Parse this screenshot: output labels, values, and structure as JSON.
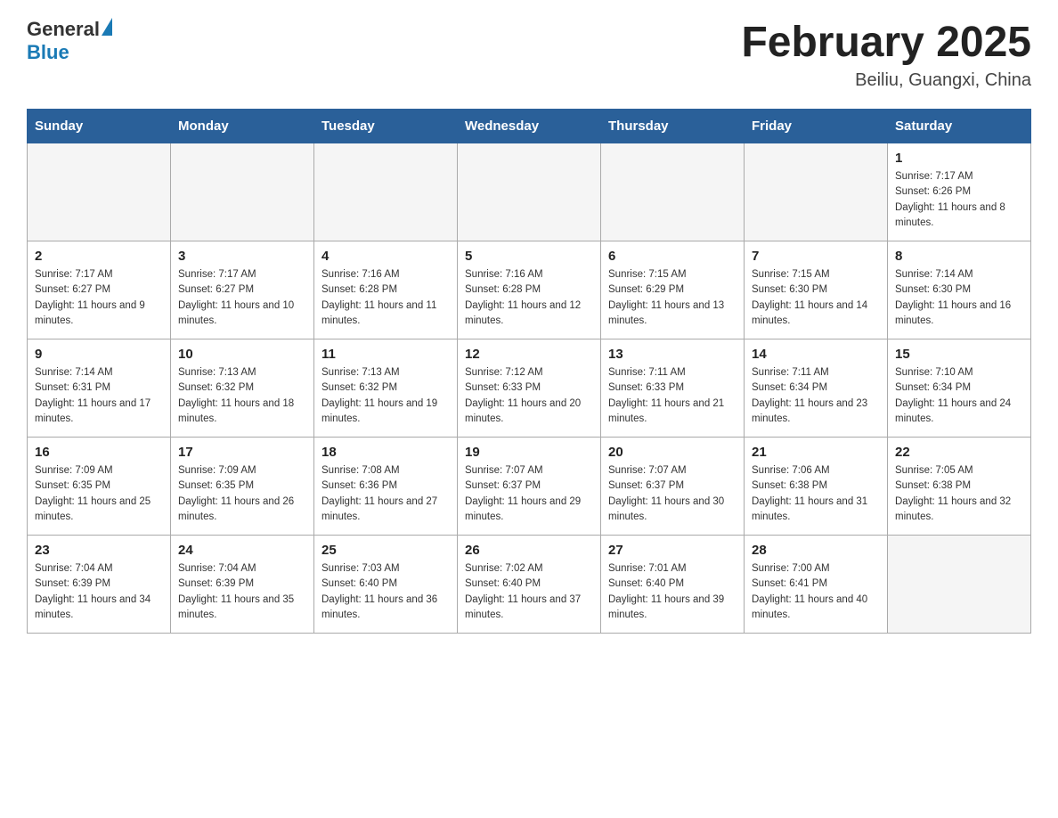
{
  "header": {
    "logo_general": "General",
    "logo_blue": "Blue",
    "title": "February 2025",
    "subtitle": "Beiliu, Guangxi, China"
  },
  "weekdays": [
    "Sunday",
    "Monday",
    "Tuesday",
    "Wednesday",
    "Thursday",
    "Friday",
    "Saturday"
  ],
  "weeks": [
    [
      {
        "day": "",
        "sunrise": "",
        "sunset": "",
        "daylight": ""
      },
      {
        "day": "",
        "sunrise": "",
        "sunset": "",
        "daylight": ""
      },
      {
        "day": "",
        "sunrise": "",
        "sunset": "",
        "daylight": ""
      },
      {
        "day": "",
        "sunrise": "",
        "sunset": "",
        "daylight": ""
      },
      {
        "day": "",
        "sunrise": "",
        "sunset": "",
        "daylight": ""
      },
      {
        "day": "",
        "sunrise": "",
        "sunset": "",
        "daylight": ""
      },
      {
        "day": "1",
        "sunrise": "Sunrise: 7:17 AM",
        "sunset": "Sunset: 6:26 PM",
        "daylight": "Daylight: 11 hours and 8 minutes."
      }
    ],
    [
      {
        "day": "2",
        "sunrise": "Sunrise: 7:17 AM",
        "sunset": "Sunset: 6:27 PM",
        "daylight": "Daylight: 11 hours and 9 minutes."
      },
      {
        "day": "3",
        "sunrise": "Sunrise: 7:17 AM",
        "sunset": "Sunset: 6:27 PM",
        "daylight": "Daylight: 11 hours and 10 minutes."
      },
      {
        "day": "4",
        "sunrise": "Sunrise: 7:16 AM",
        "sunset": "Sunset: 6:28 PM",
        "daylight": "Daylight: 11 hours and 11 minutes."
      },
      {
        "day": "5",
        "sunrise": "Sunrise: 7:16 AM",
        "sunset": "Sunset: 6:28 PM",
        "daylight": "Daylight: 11 hours and 12 minutes."
      },
      {
        "day": "6",
        "sunrise": "Sunrise: 7:15 AM",
        "sunset": "Sunset: 6:29 PM",
        "daylight": "Daylight: 11 hours and 13 minutes."
      },
      {
        "day": "7",
        "sunrise": "Sunrise: 7:15 AM",
        "sunset": "Sunset: 6:30 PM",
        "daylight": "Daylight: 11 hours and 14 minutes."
      },
      {
        "day": "8",
        "sunrise": "Sunrise: 7:14 AM",
        "sunset": "Sunset: 6:30 PM",
        "daylight": "Daylight: 11 hours and 16 minutes."
      }
    ],
    [
      {
        "day": "9",
        "sunrise": "Sunrise: 7:14 AM",
        "sunset": "Sunset: 6:31 PM",
        "daylight": "Daylight: 11 hours and 17 minutes."
      },
      {
        "day": "10",
        "sunrise": "Sunrise: 7:13 AM",
        "sunset": "Sunset: 6:32 PM",
        "daylight": "Daylight: 11 hours and 18 minutes."
      },
      {
        "day": "11",
        "sunrise": "Sunrise: 7:13 AM",
        "sunset": "Sunset: 6:32 PM",
        "daylight": "Daylight: 11 hours and 19 minutes."
      },
      {
        "day": "12",
        "sunrise": "Sunrise: 7:12 AM",
        "sunset": "Sunset: 6:33 PM",
        "daylight": "Daylight: 11 hours and 20 minutes."
      },
      {
        "day": "13",
        "sunrise": "Sunrise: 7:11 AM",
        "sunset": "Sunset: 6:33 PM",
        "daylight": "Daylight: 11 hours and 21 minutes."
      },
      {
        "day": "14",
        "sunrise": "Sunrise: 7:11 AM",
        "sunset": "Sunset: 6:34 PM",
        "daylight": "Daylight: 11 hours and 23 minutes."
      },
      {
        "day": "15",
        "sunrise": "Sunrise: 7:10 AM",
        "sunset": "Sunset: 6:34 PM",
        "daylight": "Daylight: 11 hours and 24 minutes."
      }
    ],
    [
      {
        "day": "16",
        "sunrise": "Sunrise: 7:09 AM",
        "sunset": "Sunset: 6:35 PM",
        "daylight": "Daylight: 11 hours and 25 minutes."
      },
      {
        "day": "17",
        "sunrise": "Sunrise: 7:09 AM",
        "sunset": "Sunset: 6:35 PM",
        "daylight": "Daylight: 11 hours and 26 minutes."
      },
      {
        "day": "18",
        "sunrise": "Sunrise: 7:08 AM",
        "sunset": "Sunset: 6:36 PM",
        "daylight": "Daylight: 11 hours and 27 minutes."
      },
      {
        "day": "19",
        "sunrise": "Sunrise: 7:07 AM",
        "sunset": "Sunset: 6:37 PM",
        "daylight": "Daylight: 11 hours and 29 minutes."
      },
      {
        "day": "20",
        "sunrise": "Sunrise: 7:07 AM",
        "sunset": "Sunset: 6:37 PM",
        "daylight": "Daylight: 11 hours and 30 minutes."
      },
      {
        "day": "21",
        "sunrise": "Sunrise: 7:06 AM",
        "sunset": "Sunset: 6:38 PM",
        "daylight": "Daylight: 11 hours and 31 minutes."
      },
      {
        "day": "22",
        "sunrise": "Sunrise: 7:05 AM",
        "sunset": "Sunset: 6:38 PM",
        "daylight": "Daylight: 11 hours and 32 minutes."
      }
    ],
    [
      {
        "day": "23",
        "sunrise": "Sunrise: 7:04 AM",
        "sunset": "Sunset: 6:39 PM",
        "daylight": "Daylight: 11 hours and 34 minutes."
      },
      {
        "day": "24",
        "sunrise": "Sunrise: 7:04 AM",
        "sunset": "Sunset: 6:39 PM",
        "daylight": "Daylight: 11 hours and 35 minutes."
      },
      {
        "day": "25",
        "sunrise": "Sunrise: 7:03 AM",
        "sunset": "Sunset: 6:40 PM",
        "daylight": "Daylight: 11 hours and 36 minutes."
      },
      {
        "day": "26",
        "sunrise": "Sunrise: 7:02 AM",
        "sunset": "Sunset: 6:40 PM",
        "daylight": "Daylight: 11 hours and 37 minutes."
      },
      {
        "day": "27",
        "sunrise": "Sunrise: 7:01 AM",
        "sunset": "Sunset: 6:40 PM",
        "daylight": "Daylight: 11 hours and 39 minutes."
      },
      {
        "day": "28",
        "sunrise": "Sunrise: 7:00 AM",
        "sunset": "Sunset: 6:41 PM",
        "daylight": "Daylight: 11 hours and 40 minutes."
      },
      {
        "day": "",
        "sunrise": "",
        "sunset": "",
        "daylight": ""
      }
    ]
  ]
}
